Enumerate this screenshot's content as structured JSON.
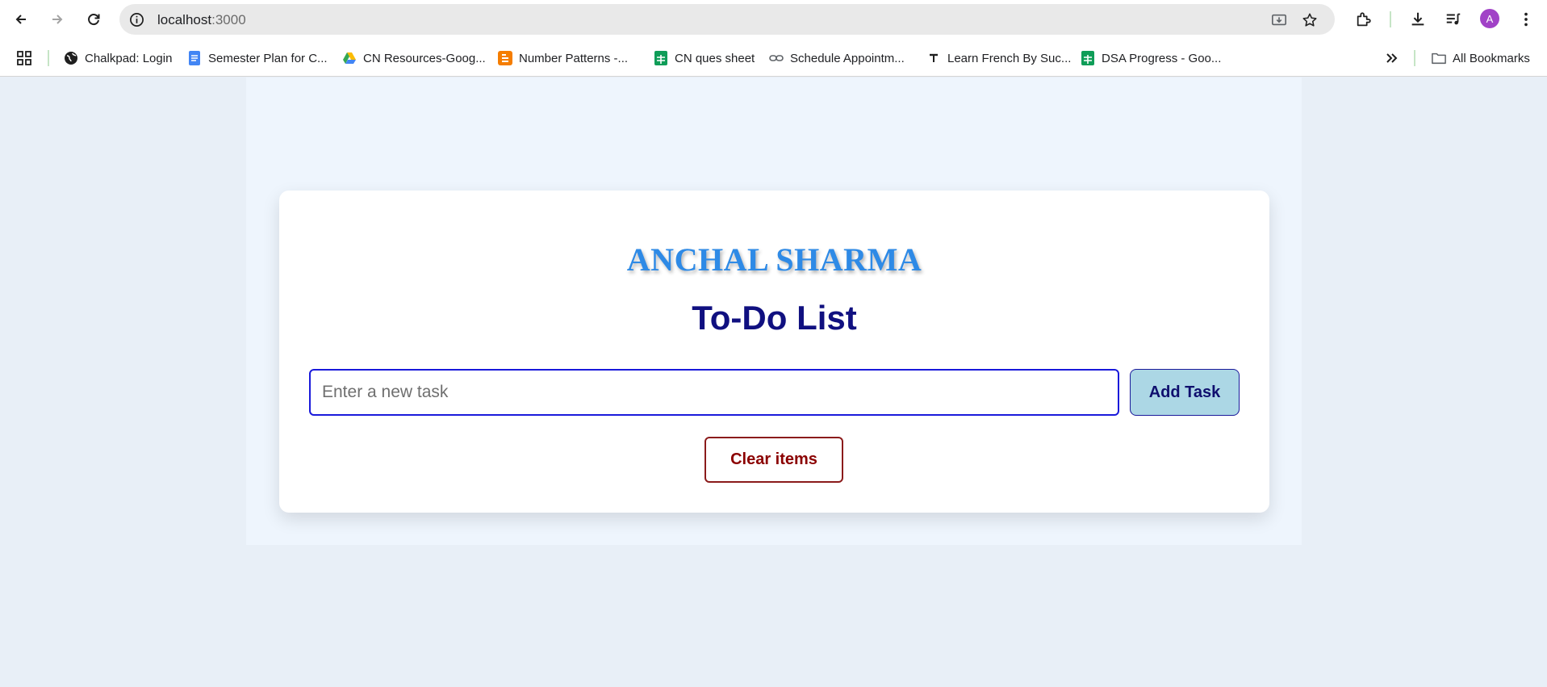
{
  "browser": {
    "url_host": "localhost",
    "url_port": ":3000",
    "avatar_letter": "A",
    "bookmarks": [
      {
        "label": "Chalkpad: Login",
        "icon": "globe-icon"
      },
      {
        "label": "Semester Plan for C...",
        "icon": "docs-icon"
      },
      {
        "label": "CN Resources-Goog...",
        "icon": "drive-icon"
      },
      {
        "label": "Number Patterns -...",
        "icon": "blogger-icon"
      },
      {
        "label": "CN ques sheet",
        "icon": "sheets-icon"
      },
      {
        "label": "Schedule Appointm...",
        "icon": "link-icon"
      },
      {
        "label": "Learn French By Suc...",
        "icon": "t-icon"
      },
      {
        "label": "DSA Progress - Goo...",
        "icon": "sheets-icon"
      }
    ],
    "all_bookmarks_label": "All Bookmarks"
  },
  "app": {
    "name": "ANCHAL SHARMA",
    "title": "To-Do List",
    "input_placeholder": "Enter a new task",
    "input_value": "",
    "add_label": "Add Task",
    "clear_label": "Clear items"
  },
  "colors": {
    "name": "#2e8ae6",
    "title": "#101080",
    "input_border": "#1a1adb",
    "add_bg": "#acd7e5",
    "clear_text": "#8b0000",
    "page_bg": "#e8eff7"
  }
}
